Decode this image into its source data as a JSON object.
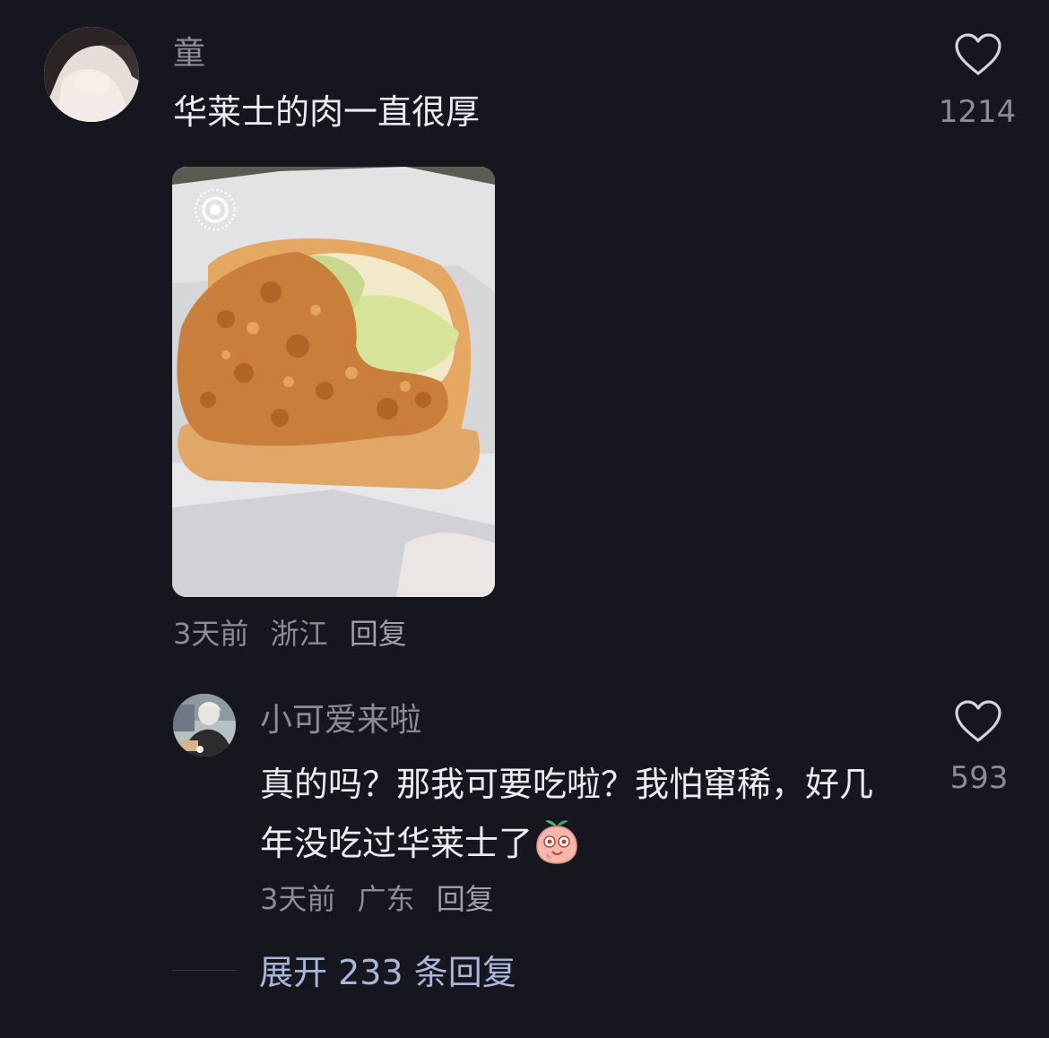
{
  "comment": {
    "username": "童",
    "text": "华莱士的肉一直很厚",
    "like_count": "1214",
    "time": "3天前",
    "location": "浙江",
    "reply_label": "回复",
    "avatar_icon": "user-avatar",
    "live_photo_icon": "live-photo-icon"
  },
  "reply": {
    "username": "小可爱来啦",
    "text": "真的吗？那我可要吃啦？我怕窜稀，好几年没吃过华莱士了",
    "like_count": "593",
    "time": "3天前",
    "location": "广东",
    "reply_label": "回复",
    "emoji_icon": "peach-emoji"
  },
  "expand": {
    "label": "展开 233 条回复"
  },
  "colors": {
    "background": "#16161e",
    "secondary_text": "#8b8c98",
    "link_blue": "#a9b6d9"
  }
}
